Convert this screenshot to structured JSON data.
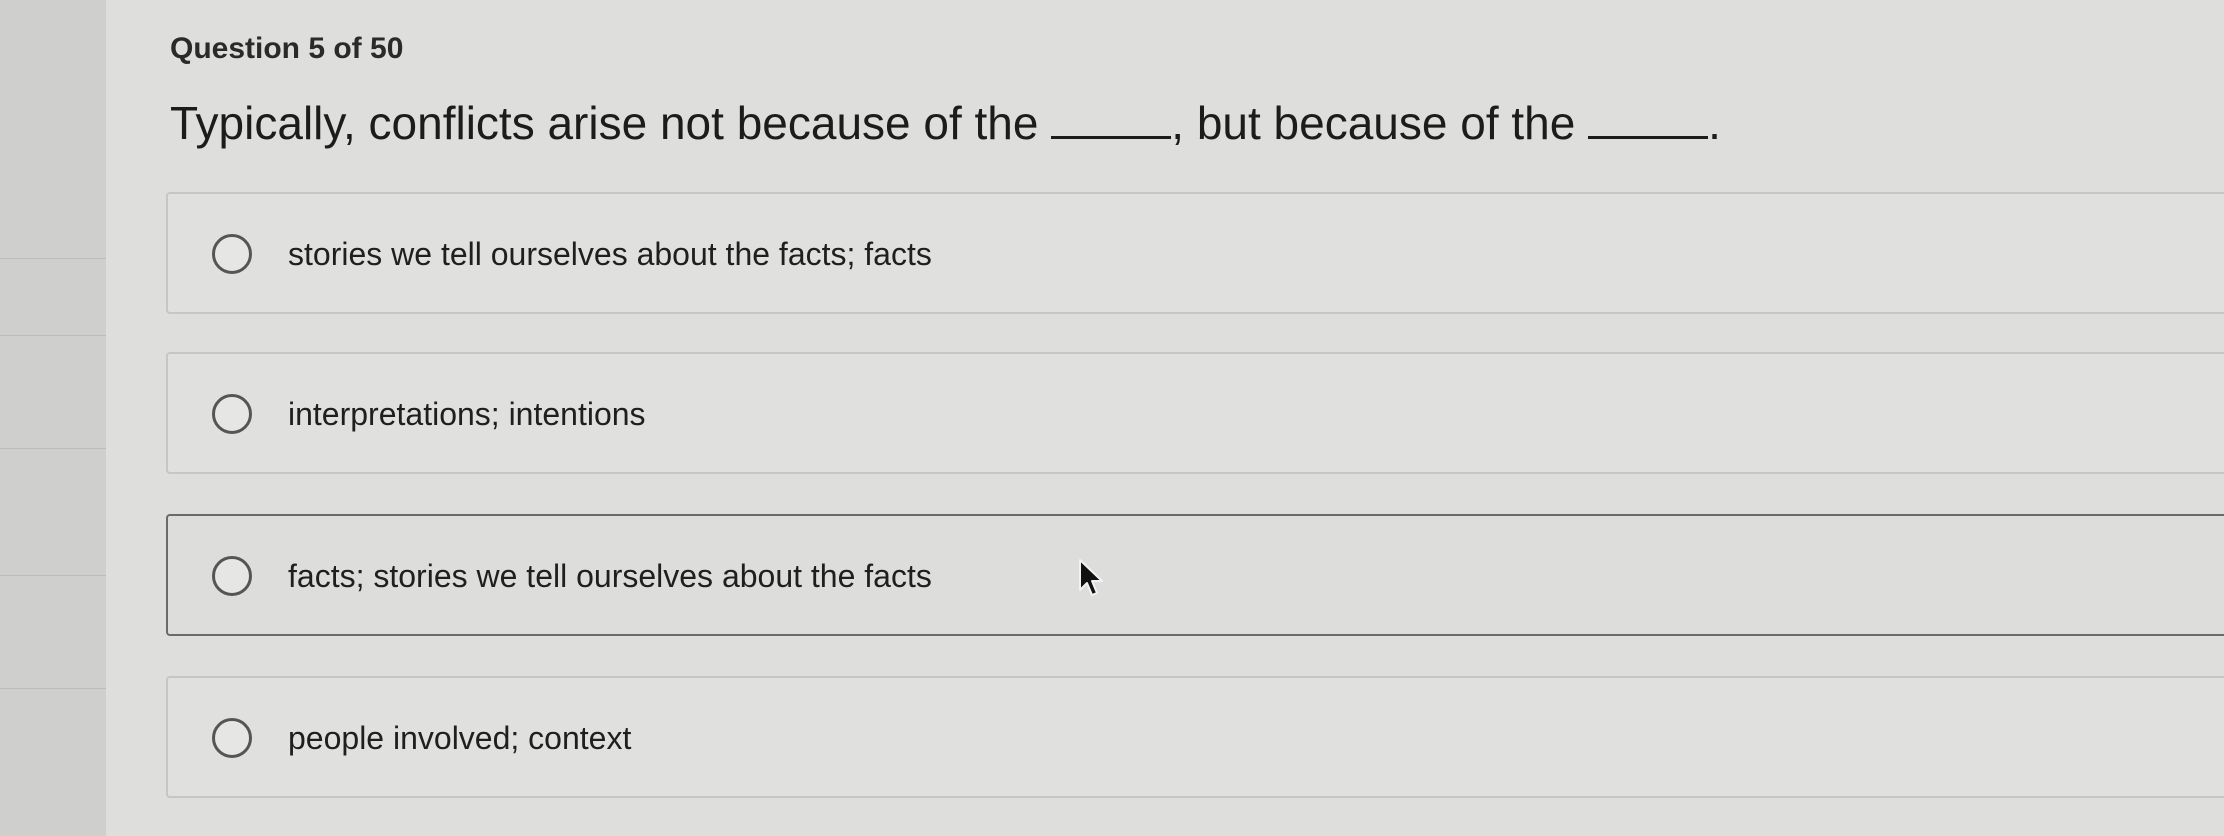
{
  "quiz": {
    "counter": "Question 5 of 50",
    "question_part1": "Typically, conflicts arise not because of the ",
    "question_part2": ", but because of the ",
    "question_part3": ".",
    "options": [
      {
        "label": "stories we tell ourselves about the facts; facts"
      },
      {
        "label": "interpretations; intentions"
      },
      {
        "label": "facts; stories we tell ourselves about the facts"
      },
      {
        "label": "people involved; context"
      }
    ]
  },
  "icons": {
    "radio": "radio-button-icon",
    "cursor": "mouse-pointer-icon"
  },
  "colors": {
    "background": "#dededc",
    "text": "#1f1f1f",
    "hover_border": "#6a6a68"
  }
}
